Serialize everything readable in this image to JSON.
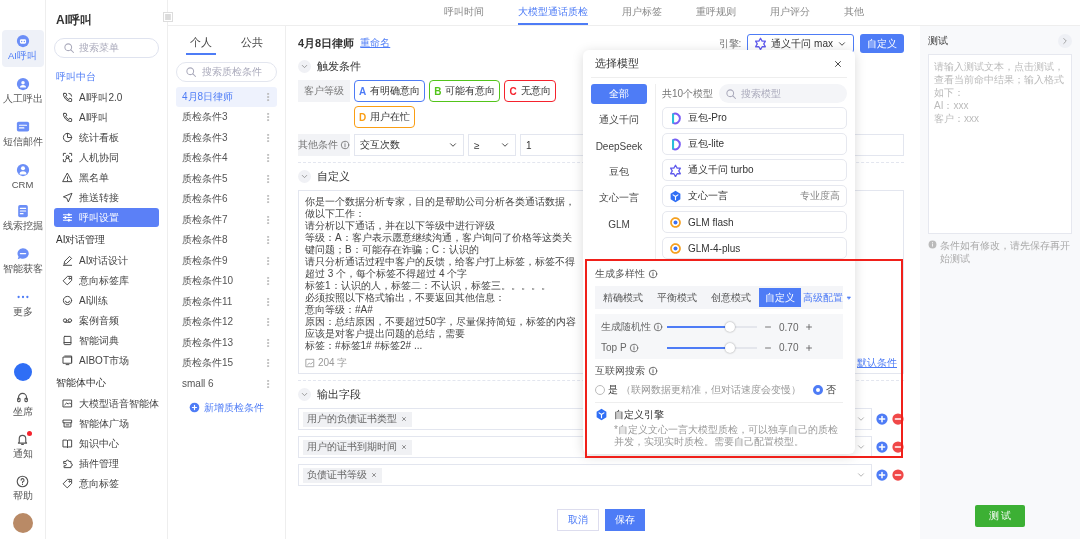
{
  "rail": {
    "items": [
      {
        "label": "AI呼叫",
        "selected": true
      },
      {
        "label": "人工呼出",
        "selected": false
      },
      {
        "label": "短信邮件",
        "selected": false
      },
      {
        "label": "CRM",
        "selected": false
      },
      {
        "label": "线索挖掘",
        "selected": false
      },
      {
        "label": "智能获客",
        "selected": false
      },
      {
        "label": "更多",
        "selected": false
      }
    ],
    "bottom": [
      {
        "label": "坐席",
        "alert": false
      },
      {
        "label": "通知",
        "alert": true
      },
      {
        "label": "帮助",
        "alert": false
      }
    ]
  },
  "menu": {
    "title": "AI呼叫",
    "search_placeholder": "搜索菜单",
    "groups": [
      {
        "title": "呼叫中台",
        "items": [
          {
            "label": "AI呼叫2.0",
            "selected": false
          },
          {
            "label": "AI呼叫",
            "selected": false
          },
          {
            "label": "统计看板",
            "selected": false
          },
          {
            "label": "人机协同",
            "selected": false
          },
          {
            "label": "黑名单",
            "selected": false
          },
          {
            "label": "推送转接",
            "selected": false
          },
          {
            "label": "呼叫设置",
            "selected": true
          }
        ]
      },
      {
        "title": "AI对话管理",
        "items": [
          {
            "label": "AI对话设计",
            "selected": false
          },
          {
            "label": "意向标签库",
            "selected": false
          },
          {
            "label": "AI训练",
            "selected": false
          },
          {
            "label": "案例音频",
            "selected": false
          },
          {
            "label": "智能词典",
            "selected": false
          },
          {
            "label": "AIBOT市场",
            "selected": false
          }
        ]
      },
      {
        "title": "智能体中心",
        "items": [
          {
            "label": "大模型语音智能体",
            "selected": false
          },
          {
            "label": "智能体广场",
            "selected": false
          },
          {
            "label": "知识中心",
            "selected": false
          },
          {
            "label": "插件管理",
            "selected": false
          },
          {
            "label": "意向标签",
            "selected": false
          }
        ]
      }
    ]
  },
  "conditions": {
    "tabs": [
      {
        "label": "个人",
        "selected": true
      },
      {
        "label": "公共",
        "selected": false
      }
    ],
    "search_placeholder": "搜索质检条件",
    "items": [
      {
        "label": "4月8日律师",
        "selected": true
      },
      {
        "label": "质检条件3",
        "selected": false
      },
      {
        "label": "质检条件3",
        "selected": false
      },
      {
        "label": "质检条件4",
        "selected": false
      },
      {
        "label": "质检条件5",
        "selected": false
      },
      {
        "label": "质检条件6",
        "selected": false
      },
      {
        "label": "质检条件7",
        "selected": false
      },
      {
        "label": "质检条件8",
        "selected": false
      },
      {
        "label": "质检条件9",
        "selected": false
      },
      {
        "label": "质检条件10",
        "selected": false
      },
      {
        "label": "质检条件11",
        "selected": false
      },
      {
        "label": "质检条件12",
        "selected": false
      },
      {
        "label": "质检条件13",
        "selected": false
      },
      {
        "label": "质检条件15",
        "selected": false
      },
      {
        "label": "small 6",
        "selected": false
      }
    ],
    "add_label": "新增质检条件"
  },
  "top_tabs": [
    {
      "label": "呼叫时间",
      "selected": false
    },
    {
      "label": "大模型通话质检",
      "selected": true
    },
    {
      "label": "用户标签",
      "selected": false
    },
    {
      "label": "重呼规则",
      "selected": false
    },
    {
      "label": "用户评分",
      "selected": false
    },
    {
      "label": "其他",
      "selected": false
    }
  ],
  "main": {
    "title": "4月8日律师",
    "rename": "重命名",
    "engine_label": "引擎:",
    "engine": "通义千问 max",
    "custom_button": "自定义",
    "trigger": {
      "title": "触发条件",
      "grade_label": "客户等级",
      "grades": [
        {
          "letter": "A",
          "label": "有明确意向",
          "color": "#4e7cf6"
        },
        {
          "letter": "B",
          "label": "可能有意向",
          "color": "#52c41a"
        },
        {
          "letter": "C",
          "label": "无意向",
          "color": "#f5222d"
        },
        {
          "letter": "D",
          "label": "用户在忙",
          "color": "#fa9e14"
        }
      ],
      "other_label": "其他条件",
      "other_field": "交互次数",
      "operator": "≥",
      "value": "1"
    },
    "custom": {
      "title": "自定义",
      "lines": [
        "你是一个数据分析专家，目的是帮助公司分析各类通话数据，做以下工作：",
        "请分析以下通话，并在以下等级中进行评级",
        "等级：A：客户表示愿意继续沟通，客户询问了价格等这类关键问题；B：可能存在诈骗；C：认识的",
        "请只分析通话过程中客户的反馈，给客户打上标签，标签不得超过 3 个，每个标签不得超过 4 个字",
        "标签1：认识的人，标签二：不认识，标签三。。。。。",
        "必须按照以下格式输出，不要返回其他信息：",
        "意向等级：#A#",
        "原因：总结原因，不要超过50字，尽量保持简短，标签的内容应该是对客户提出问题的总结，需要",
        "标签：#标签1# #标签2# ..."
      ],
      "count": "204 字",
      "default_link": "默认条件"
    },
    "output": {
      "title": "输出字段",
      "fields": [
        {
          "tag": "用户的负债证书类型"
        },
        {
          "tag": "用户的证书到期时间"
        },
        {
          "tag": "负债证书等级"
        }
      ]
    },
    "cancel": "取消",
    "save": "保存"
  },
  "model_picker": {
    "title": "选择模型",
    "categories": [
      {
        "label": "全部",
        "selected": true
      },
      {
        "label": "通义千问",
        "selected": false
      },
      {
        "label": "DeepSeek",
        "selected": false
      },
      {
        "label": "豆包",
        "selected": false
      },
      {
        "label": "文心一言",
        "selected": false
      },
      {
        "label": "GLM",
        "selected": false
      }
    ],
    "count": "共10个模型",
    "search_placeholder": "搜索模型",
    "models": [
      {
        "name": "豆包-Pro",
        "kind": "doubao"
      },
      {
        "name": "豆包-lite",
        "kind": "doubao"
      },
      {
        "name": "通义千问 turbo",
        "kind": "tongyi"
      },
      {
        "name": "文心一言",
        "kind": "wenxin",
        "badge": "专业度高"
      },
      {
        "name": "GLM flash",
        "kind": "glm"
      },
      {
        "name": "GLM-4-plus",
        "kind": "glm"
      }
    ],
    "diversity_label": "生成多样性",
    "modes": [
      {
        "label": "精确模式",
        "selected": false
      },
      {
        "label": "平衡模式",
        "selected": false
      },
      {
        "label": "创意模式",
        "selected": false
      },
      {
        "label": "自定义",
        "selected": true
      }
    ],
    "advanced": "高级配置",
    "params": [
      {
        "label": "生成随机性",
        "level": 0.7,
        "reading": "0.70"
      },
      {
        "label": "Top P",
        "level": 0.7,
        "reading": "0.70"
      }
    ],
    "search_label": "互联网搜索",
    "search_options": [
      {
        "label": "是",
        "note": "（联网数据更精准，但对话速度会变慢）",
        "selected": false
      },
      {
        "label": "否",
        "selected": true
      }
    ],
    "engine_title": "自定义引擎",
    "engine_desc": "*自定义文心一言大模型质检，可以独享自己的质检并发，实现实时质检。需要自己配置模型。"
  },
  "test_panel": {
    "title": "测试",
    "placeholder": "请输入测试文本，点击测试，查看当前命中结果；输入格式如下：\nAI：xxx\n客户：xxx",
    "hint": "条件如有修改，请先保存再开始测试",
    "button": "测 试"
  }
}
